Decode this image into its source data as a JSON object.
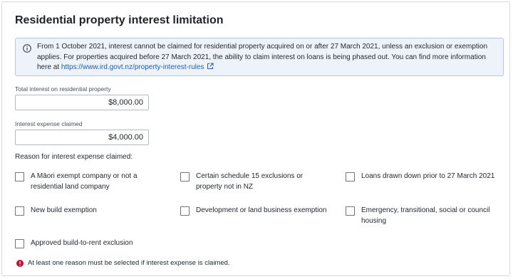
{
  "section": {
    "title": "Residential property interest limitation"
  },
  "info": {
    "icon": "info-icon",
    "text": "From 1 October 2021, interest cannot be claimed for residential property acquired on or after 27 March 2021, unless an exclusion or exemption applies. For properties acquired before 27 March 2021, the ability to claim interest on loans is being phased out. You can find more information here at ",
    "link_text": "https://www.ird.govt.nz/property-interest-rules",
    "link_icon": "external-link-icon"
  },
  "fields": {
    "total_interest": {
      "label": "Total interest on residential property",
      "value": "$8,000.00"
    },
    "interest_claimed": {
      "label": "Interest expense claimed",
      "value": "$4,000.00"
    }
  },
  "reasons": {
    "label": "Reason for interest expense claimed:",
    "options": [
      "A Māori exempt company or not a residential land company",
      "Certain schedule 15 exclusions or property not in NZ",
      "Loans drawn down prior to 27 March 2021",
      "New build exemption",
      "Development or land business exemption",
      "Emergency, transitional, social or council housing",
      "Approved build-to-rent exclusion"
    ],
    "checked": [
      false,
      false,
      false,
      false,
      false,
      false,
      false
    ]
  },
  "error": {
    "icon": "error-icon",
    "text": "At least one reason must be selected if interest expense is claimed."
  },
  "colors": {
    "info_background": "#eef3fb",
    "info_border": "#b9c7dd",
    "link": "#1b5fb8",
    "error": "#c8102e"
  }
}
